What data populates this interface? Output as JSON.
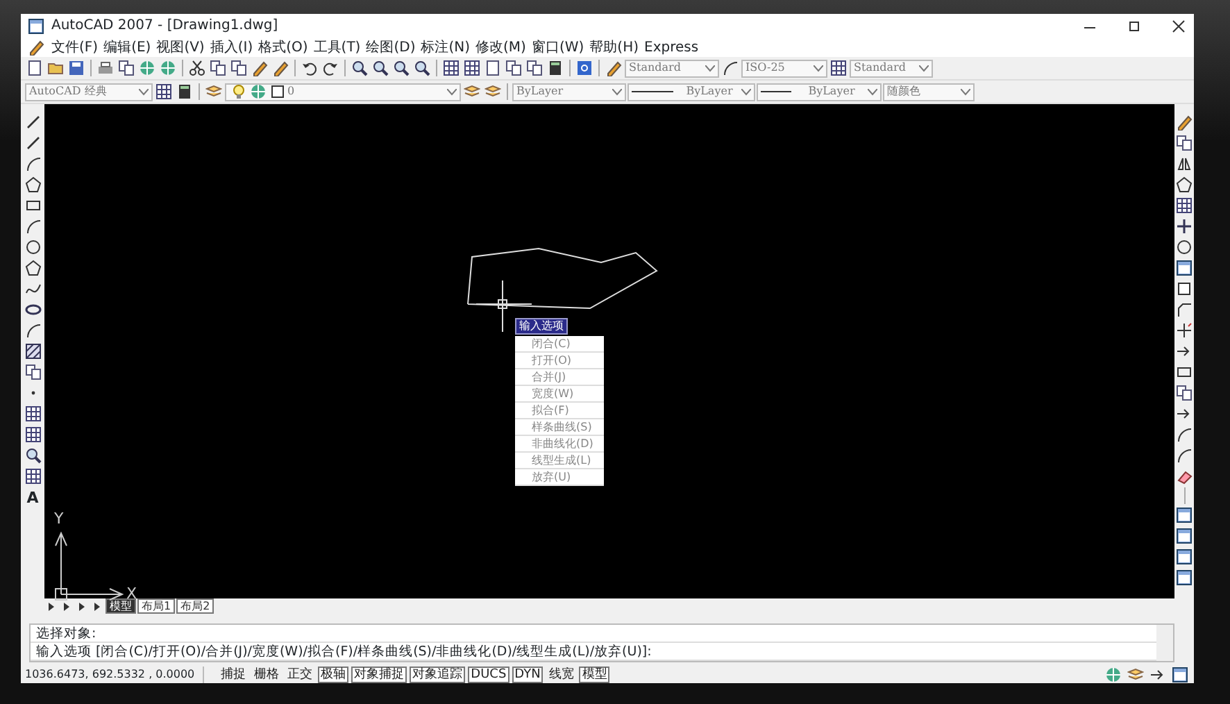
{
  "window": {
    "title": "AutoCAD 2007 - [Drawing1.dwg]"
  },
  "menu": [
    "文件(F)",
    "编辑(E)",
    "视图(V)",
    "插入(I)",
    "格式(O)",
    "工具(T)",
    "绘图(D)",
    "标注(N)",
    "修改(M)",
    "窗口(W)",
    "帮助(H)",
    "Express"
  ],
  "styles_toolbar": {
    "text_style": "Standard",
    "dim_style": "ISO-25",
    "table_style": "Standard"
  },
  "properties_bar": {
    "workspace": "AutoCAD 经典",
    "layer": "0",
    "color_setting": "ByLayer",
    "linetype": "ByLayer",
    "lineweight": "ByLayer",
    "plot_style": "随颜色"
  },
  "draw_toolbar": {
    "text_tool": "A"
  },
  "canvas": {
    "popup": {
      "title": "输入选项",
      "items": [
        "闭合(C)",
        "打开(O)",
        "合并(J)",
        "宽度(W)",
        "拟合(F)",
        "样条曲线(S)",
        "非曲线化(D)",
        "线型生成(L)",
        "放弃(U)"
      ]
    },
    "ucs": {
      "x_label": "X",
      "y_label": "Y"
    }
  },
  "layout_tabs": [
    {
      "label": "模型",
      "selected": true
    },
    {
      "label": "布局1",
      "selected": false
    },
    {
      "label": "布局2",
      "selected": false
    }
  ],
  "command_lines": [
    "选择对象:",
    "输入选项 [闭合(C)/打开(O)/合并(J)/宽度(W)/拟合(F)/样条曲线(S)/非曲线化(D)/线型生成(L)/放弃(U)]:"
  ],
  "status_bar": {
    "coordinates": "1036.6473, 692.5332 , 0.0000",
    "toggles": [
      {
        "label": "捕捉",
        "on": false
      },
      {
        "label": "栅格",
        "on": false
      },
      {
        "label": "正交",
        "on": false
      },
      {
        "label": "极轴",
        "on": true
      },
      {
        "label": "对象捕捉",
        "on": true
      },
      {
        "label": "对象追踪",
        "on": true
      },
      {
        "label": "DUCS",
        "on": true
      },
      {
        "label": "DYN",
        "on": true
      },
      {
        "label": "线宽",
        "on": false
      },
      {
        "label": "模型",
        "on": true
      }
    ]
  }
}
